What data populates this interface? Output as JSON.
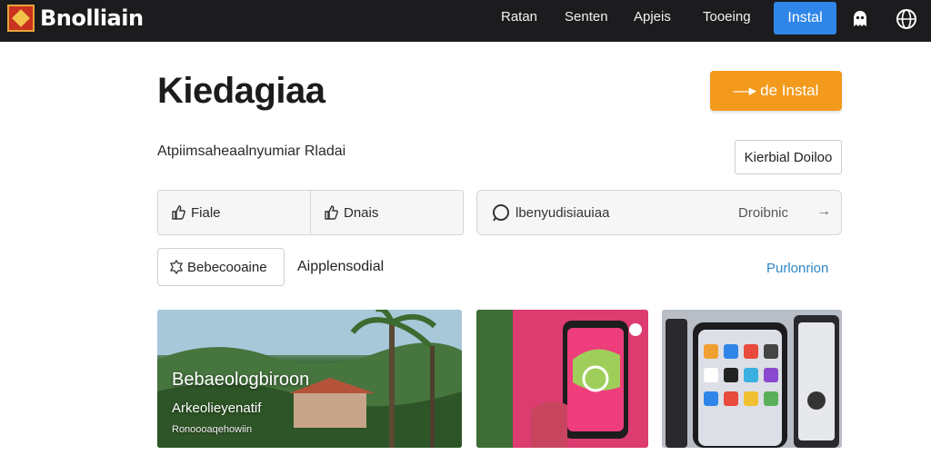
{
  "header": {
    "brand": "Bnolliain",
    "nav": [
      "Ratan",
      "Senten",
      "Apjeis",
      "Tooeing"
    ],
    "install_label": "Instal",
    "icons": [
      "ghost-icon",
      "globe-icon"
    ]
  },
  "main": {
    "title": "Kiedagiaa",
    "primary_cta": "de Instal",
    "subtitle": "Atpiimsaheaalnyumiar Rladai",
    "secondary_button": "Kierbial Doiloo",
    "segments": [
      "Fiale",
      "Dnais"
    ],
    "search": {
      "placeholder": "lbenyudisiauiaa",
      "meta": "Droibnic"
    },
    "chip_label": "Bebecooaine",
    "filter_text": "Aipplensodial",
    "link_text": "Purlonrion"
  },
  "cards": [
    {
      "title": "Bebaeologbiroon",
      "subtitle": "Arkeolieyenatif",
      "small": "Ronoooaqehowiin"
    }
  ],
  "colors": {
    "topbar": "#1c1c1e",
    "accent_blue": "#2f86e8",
    "accent_orange": "#f39a1c",
    "link": "#2f86c8"
  }
}
